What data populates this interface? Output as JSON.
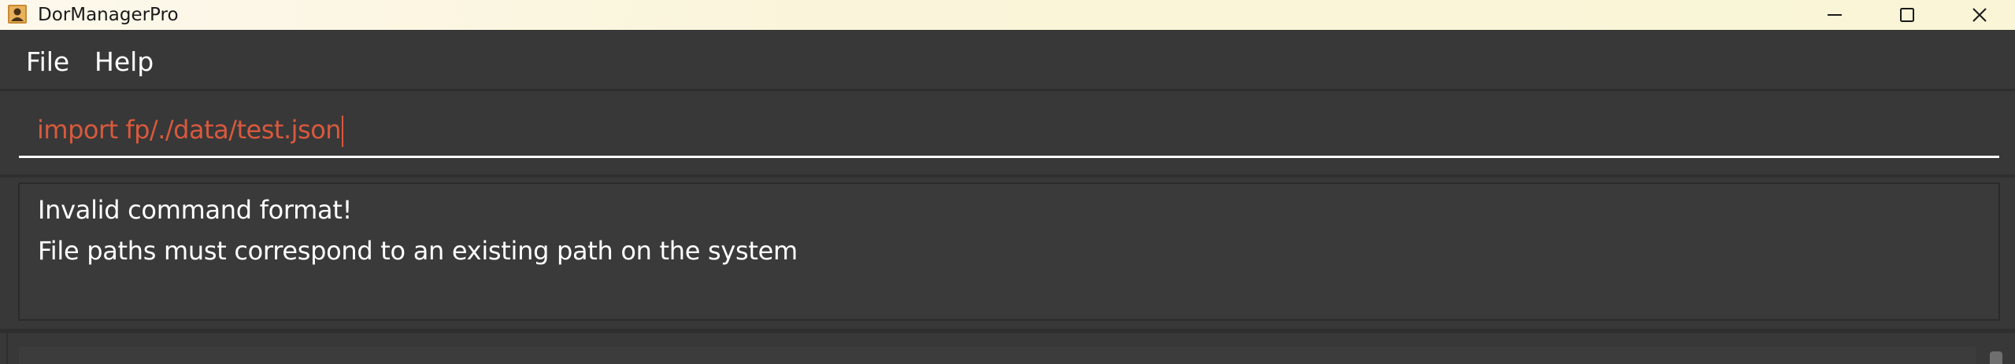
{
  "window": {
    "title": "DorManagerPro",
    "icon": "user-icon",
    "controls": {
      "minimize": "minimize-icon",
      "maximize": "maximize-icon",
      "close": "close-icon"
    }
  },
  "menu": {
    "items": [
      {
        "label": "File"
      },
      {
        "label": "Help"
      }
    ]
  },
  "command": {
    "value": "import fp/./data/test.json"
  },
  "result": {
    "lines": [
      "Invalid command format!",
      "File paths must correspond to an existing path on the system"
    ]
  },
  "colors": {
    "command_text": "#d9593d",
    "background": "#383838",
    "text": "#ffffff"
  }
}
